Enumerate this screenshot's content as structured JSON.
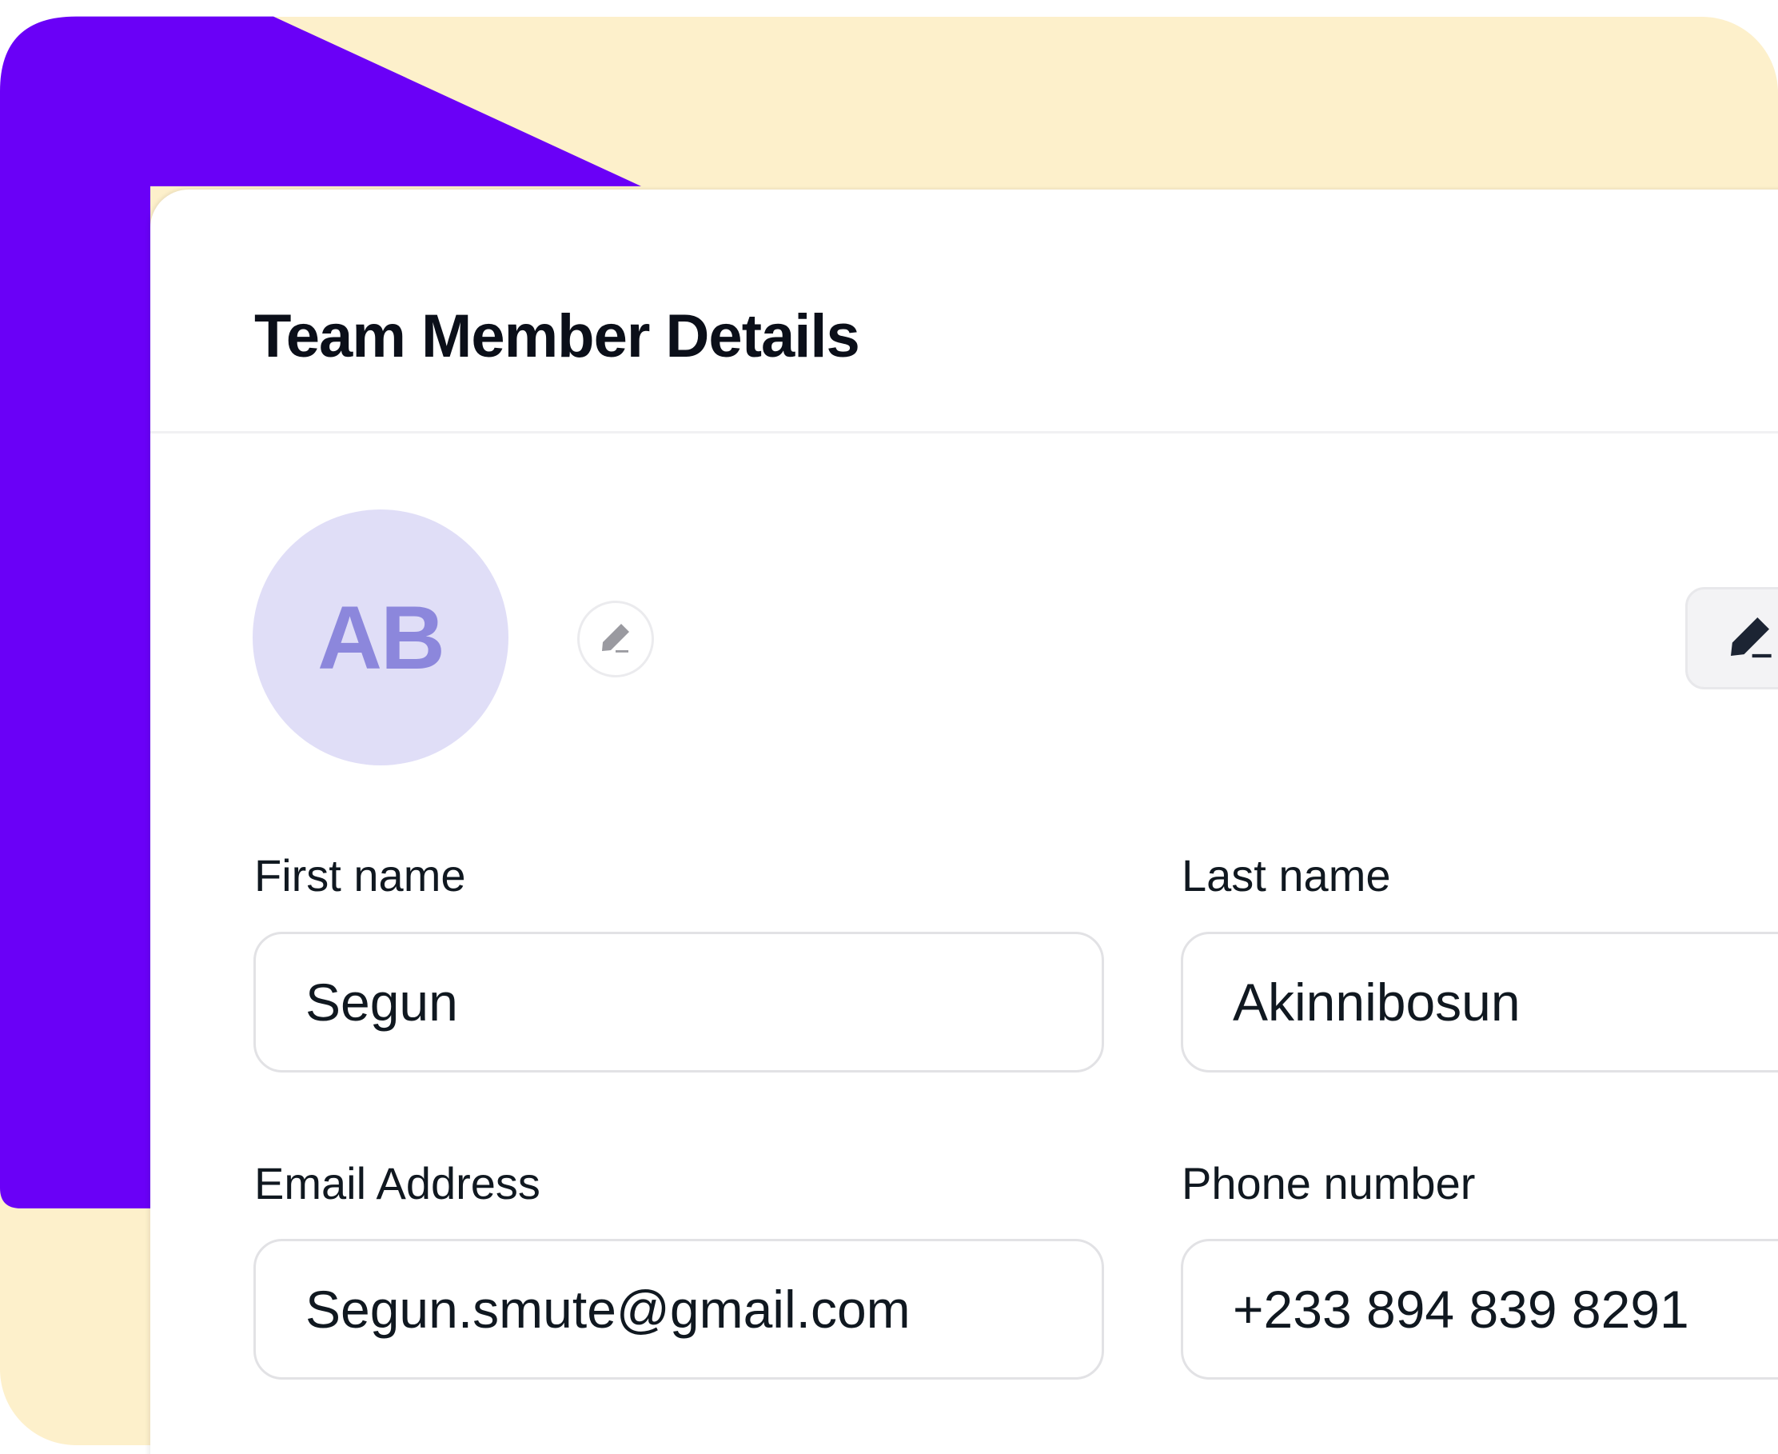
{
  "card": {
    "title": "Team Member Details"
  },
  "avatar": {
    "initials": "AB",
    "edit_icon": "pencil-icon"
  },
  "edit_button": {
    "icon": "pencil-icon"
  },
  "form": {
    "first_name": {
      "label": "First name",
      "value": "Segun"
    },
    "last_name": {
      "label": "Last name",
      "value": "Akinnibosun"
    },
    "email": {
      "label": "Email Address",
      "value": "Segun.smute@gmail.com"
    },
    "phone": {
      "label": "Phone number",
      "value": "+233 894 839 8291"
    }
  },
  "colors": {
    "purple": "#6A00F7",
    "cream": "#FDF0CB",
    "avatar_bg": "#E0DEF7",
    "avatar_text": "#8C87DC"
  }
}
